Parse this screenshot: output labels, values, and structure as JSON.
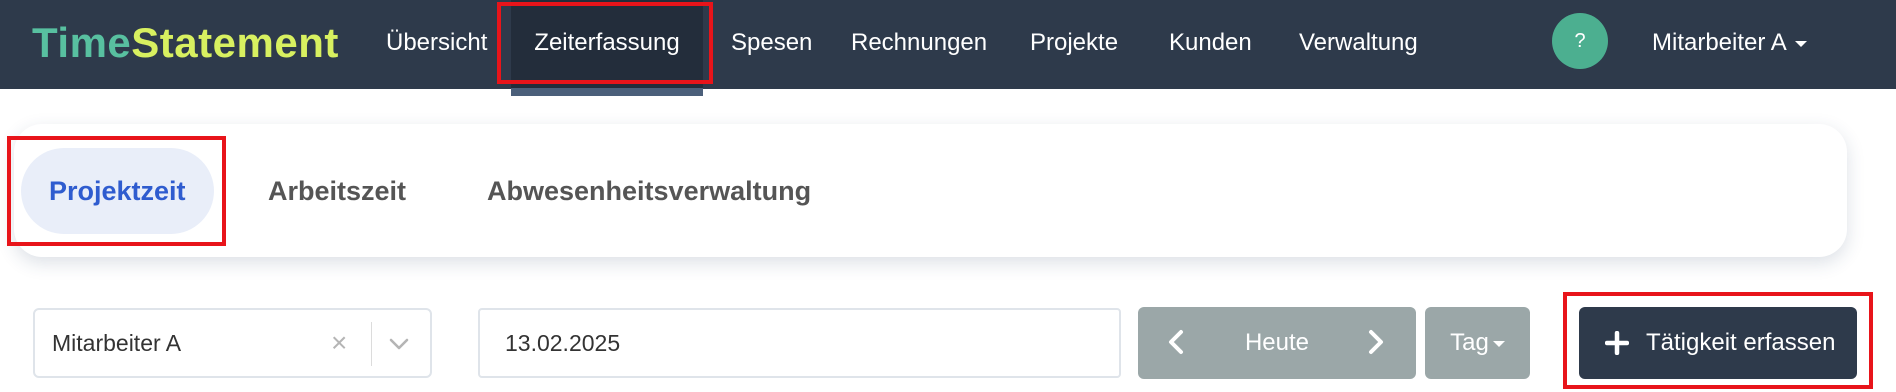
{
  "app": {
    "brand_part1": "Time",
    "brand_part2": "Statement"
  },
  "nav": {
    "items": [
      {
        "label": "Übersicht"
      },
      {
        "label": "Zeiterfassung",
        "active": true
      },
      {
        "label": "Spesen"
      },
      {
        "label": "Rechnungen"
      },
      {
        "label": "Projekte"
      },
      {
        "label": "Kunden"
      },
      {
        "label": "Verwaltung"
      }
    ],
    "help_label": "?",
    "user_label": "Mitarbeiter A"
  },
  "tabs": {
    "items": [
      {
        "label": "Projektzeit",
        "active": true
      },
      {
        "label": "Arbeitszeit"
      },
      {
        "label": "Abwesenheitsverwaltung"
      }
    ]
  },
  "filters": {
    "employee_value": "Mitarbeiter A",
    "clear_symbol": "×",
    "date_value": "13.02.2025",
    "today_label": "Heute",
    "view_label": "Tag",
    "add_activity_label": "Tätigkeit erfassen"
  },
  "colors": {
    "navbar": "#2e3a4b",
    "brand_time": "#58c0a0",
    "brand_statement": "#d8f060",
    "active_tab_text": "#2f5ccf",
    "active_tab_bg": "#e9eef9",
    "grey_button": "#9ba7a8",
    "help_circle": "#4caf90",
    "annotation": "#e8141a"
  },
  "icons": [
    "chevron-down-icon",
    "chevron-left-icon",
    "chevron-right-icon",
    "plus-icon",
    "close-icon",
    "caret-down-icon"
  ]
}
